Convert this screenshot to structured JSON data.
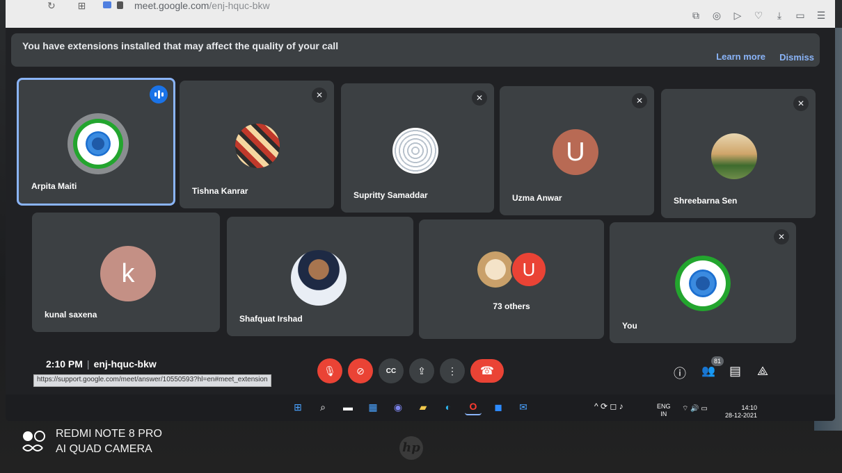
{
  "browser": {
    "url_host": "meet.google.com",
    "url_path": "/enj-hquc-bkw",
    "nav_glyphs": "↻ ⊞",
    "toolbar_icons": [
      "⧉",
      "◎",
      "▷",
      "♡",
      "⤓",
      "▭",
      "☰"
    ]
  },
  "banner": {
    "message": "You have extensions installed that may affect the quality of your call",
    "learn_more": "Learn more",
    "dismiss": "Dismiss"
  },
  "participants": [
    {
      "name": "Arpita Maiti",
      "speaking": true,
      "avatar": "emblem"
    },
    {
      "name": "Tishna Kanrar",
      "muted": true,
      "avatar": "photo"
    },
    {
      "name": "Supritty Samaddar",
      "muted": true,
      "avatar": "pattern"
    },
    {
      "name": "Uzma Anwar",
      "muted": true,
      "avatar": "letter",
      "letter": "U",
      "color": "#b86a54"
    },
    {
      "name": "Shreebarna Sen",
      "muted": true,
      "avatar": "photo"
    },
    {
      "name": "kunal saxena",
      "avatar": "letter",
      "letter": "k",
      "color": "#c49085"
    },
    {
      "name": "Shafquat Irshad",
      "avatar": "photo"
    },
    {
      "others_label": "73 others",
      "letter": "U",
      "color": "#ea4335"
    },
    {
      "name": "You",
      "muted": true,
      "avatar": "emblem"
    }
  ],
  "meeting": {
    "time": "2:10 PM",
    "separator": "|",
    "code": "enj-hquc-bkw",
    "people_count": "81",
    "status_url": "https://support.google.com/meet/answer/10550593?hl=en#meet_extension"
  },
  "controls": {
    "mic_icon": "🎙",
    "cam_icon": "⊘",
    "captions_icon": "CC",
    "present_icon": "⇪",
    "more_icon": "⋮",
    "end_icon": "☎",
    "info_icon": "ⓘ",
    "people_icon": "👥",
    "chat_icon": "▤",
    "activities_icon": "⟁"
  },
  "taskbar": {
    "icons": [
      "⊞",
      "⌕",
      "▬",
      "▦",
      "◉",
      "▰",
      "◐",
      "O",
      "◼",
      "✉"
    ],
    "tray": "^ ⟳ ◻ ♪",
    "lang_top": "ENG",
    "lang_bottom": "IN",
    "tray_icons": "⌔ 🔊 ▭",
    "time": "14:10",
    "date": "28-12-2021"
  },
  "watermark": {
    "line1": "REDMI NOTE 8 PRO",
    "line2": "AI QUAD CAMERA"
  },
  "brand": "hp",
  "colors": {
    "accent": "#8ab4f8",
    "danger": "#ea4335",
    "tile": "#3c4043",
    "bg": "#202124"
  }
}
